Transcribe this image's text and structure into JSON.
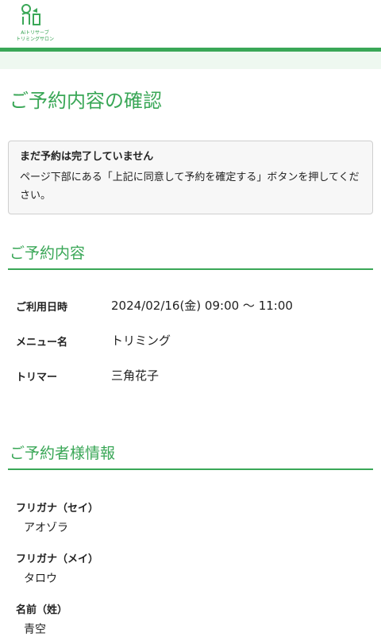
{
  "header": {
    "logo_line1": "Aiトリサーブ",
    "logo_line2": "トリミングサロン"
  },
  "page": {
    "title": "ご予約内容の確認"
  },
  "notice": {
    "title": "まだ予約は完了していません",
    "body": "ページ下部にある「上記に同意して予約を確定する」ボタンを押してください。"
  },
  "reservation": {
    "heading": "ご予約内容",
    "rows": [
      {
        "label": "ご利用日時",
        "value": "2024/02/16(金) 09:00 〜 11:00"
      },
      {
        "label": "メニュー名",
        "value": "トリミング"
      },
      {
        "label": "トリマー",
        "value": "三角花子"
      }
    ]
  },
  "customer": {
    "heading": "ご予約者様情報",
    "items": [
      {
        "label": "フリガナ（セイ）",
        "value": "アオゾラ"
      },
      {
        "label": "フリガナ（メイ）",
        "value": "タロウ"
      },
      {
        "label": "名前（姓）",
        "value": "青空"
      }
    ]
  },
  "colors": {
    "accent": "#3aa757",
    "subbar": "#eef8f0"
  }
}
